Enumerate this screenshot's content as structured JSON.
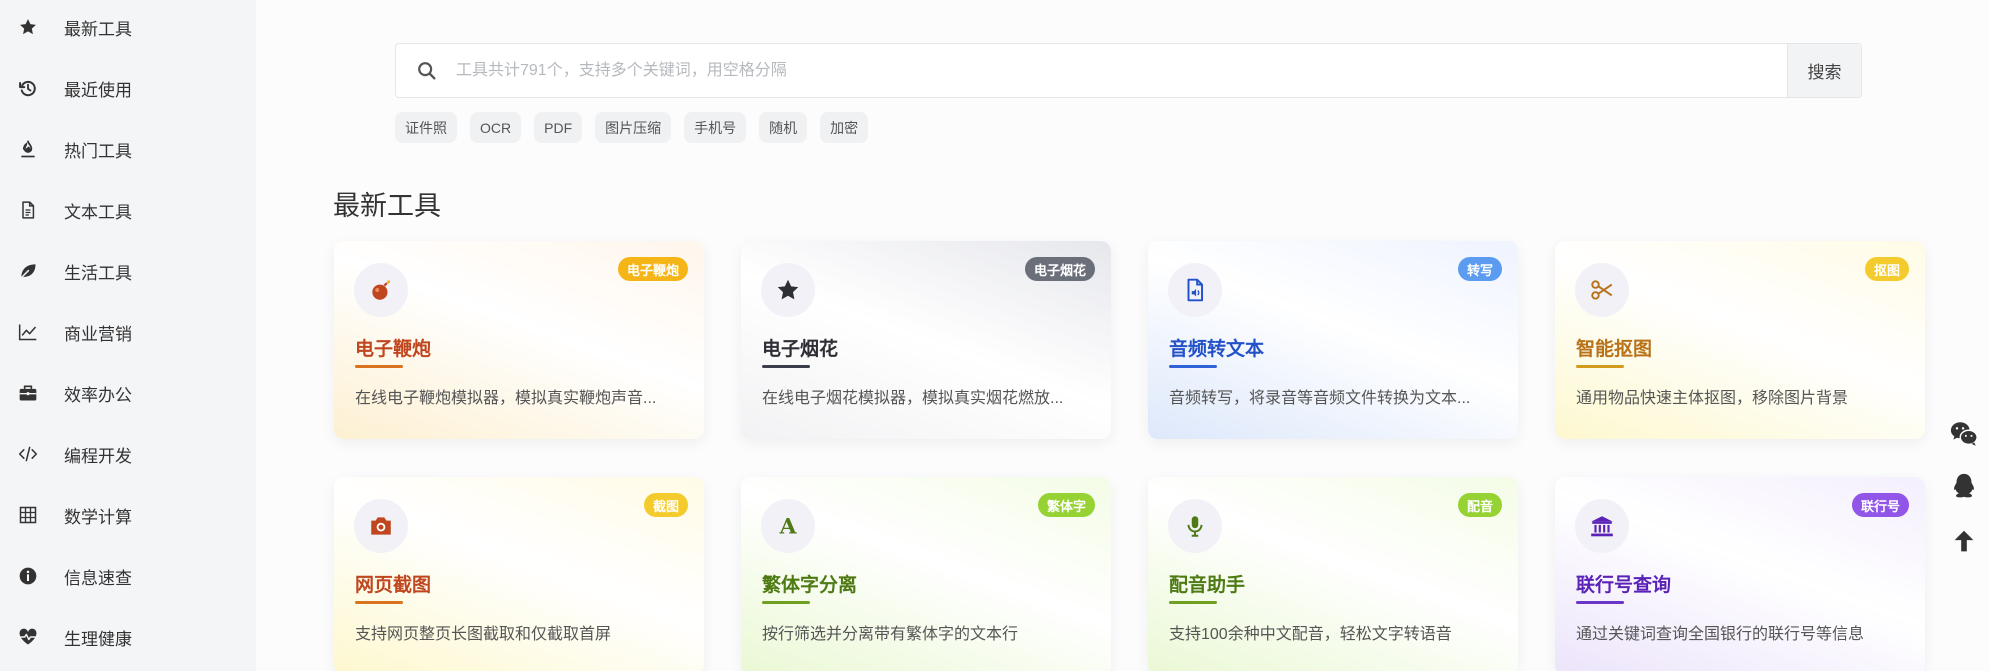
{
  "sidebar": {
    "items": [
      {
        "label": "最新工具",
        "icon": "star-icon"
      },
      {
        "label": "最近使用",
        "icon": "history-icon"
      },
      {
        "label": "热门工具",
        "icon": "fire-icon"
      },
      {
        "label": "文本工具",
        "icon": "document-icon"
      },
      {
        "label": "生活工具",
        "icon": "leaf-icon"
      },
      {
        "label": "商业营销",
        "icon": "chart-line-icon"
      },
      {
        "label": "效率办公",
        "icon": "briefcase-icon"
      },
      {
        "label": "编程开发",
        "icon": "code-icon"
      },
      {
        "label": "数学计算",
        "icon": "calculator-icon"
      },
      {
        "label": "信息速查",
        "icon": "info-icon"
      },
      {
        "label": "生理健康",
        "icon": "heartbeat-icon"
      }
    ]
  },
  "search": {
    "placeholder": "工具共计791个，支持多个关键词，用空格分隔",
    "button_label": "搜索"
  },
  "tags": [
    "证件照",
    "OCR",
    "PDF",
    "图片压缩",
    "手机号",
    "随机",
    "加密"
  ],
  "section": {
    "title": "最新工具"
  },
  "cards": [
    {
      "title": "电子鞭炮",
      "desc": "在线电子鞭炮模拟器，模拟真实鞭炮声音...",
      "badge": "电子鞭炮",
      "icon": "bomb-icon",
      "title_color": "#c0461f",
      "badge_color": "#f5b516",
      "line_color": "#d9731f"
    },
    {
      "title": "电子烟花",
      "desc": "在线电子烟花模拟器，模拟真实烟花燃放...",
      "badge": "电子烟花",
      "icon": "star-icon",
      "title_color": "#2e2e35",
      "badge_color": "#6b6f7a",
      "line_color": "#3a3d4a"
    },
    {
      "title": "音频转文本",
      "desc": "音频转写，将录音等音频文件转换为文本...",
      "badge": "转写",
      "icon": "audio-file-icon",
      "title_color": "#2351c8",
      "badge_color": "#5b9bf0",
      "line_color": "#2f62d8"
    },
    {
      "title": "智能抠图",
      "desc": "通用物品快速主体抠图，移除图片背景",
      "badge": "抠图",
      "icon": "scissors-icon",
      "title_color": "#b8731a",
      "badge_color": "#f3cb2d",
      "line_color": "#d29b1e"
    },
    {
      "title": "网页截图",
      "desc": "支持网页整页长图截取和仅截取首屏",
      "badge": "截图",
      "icon": "camera-icon",
      "title_color": "#c0461f",
      "badge_color": "#f3cb2d",
      "line_color": "#d9731f"
    },
    {
      "title": "繁体字分离",
      "desc": "按行筛选并分离带有繁体字的文本行",
      "badge": "繁体字",
      "icon": "letter-a-icon",
      "title_color": "#4e7a14",
      "badge_color": "#96d233",
      "line_color": "#6fa021"
    },
    {
      "title": "配音助手",
      "desc": "支持100余种中文配音，轻松文字转语音",
      "badge": "配音",
      "icon": "microphone-icon",
      "title_color": "#4e7a14",
      "badge_color": "#96d233",
      "line_color": "#6fa021"
    },
    {
      "title": "联行号查询",
      "desc": "通过关键词查询全国银行的联行号等信息",
      "badge": "联行号",
      "icon": "bank-icon",
      "title_color": "#5b22b8",
      "badge_color": "#9156e8",
      "line_color": "#6b36c8"
    }
  ],
  "floating": [
    {
      "icon": "wechat-icon"
    },
    {
      "icon": "qq-icon"
    },
    {
      "icon": "arrow-up-icon"
    }
  ]
}
